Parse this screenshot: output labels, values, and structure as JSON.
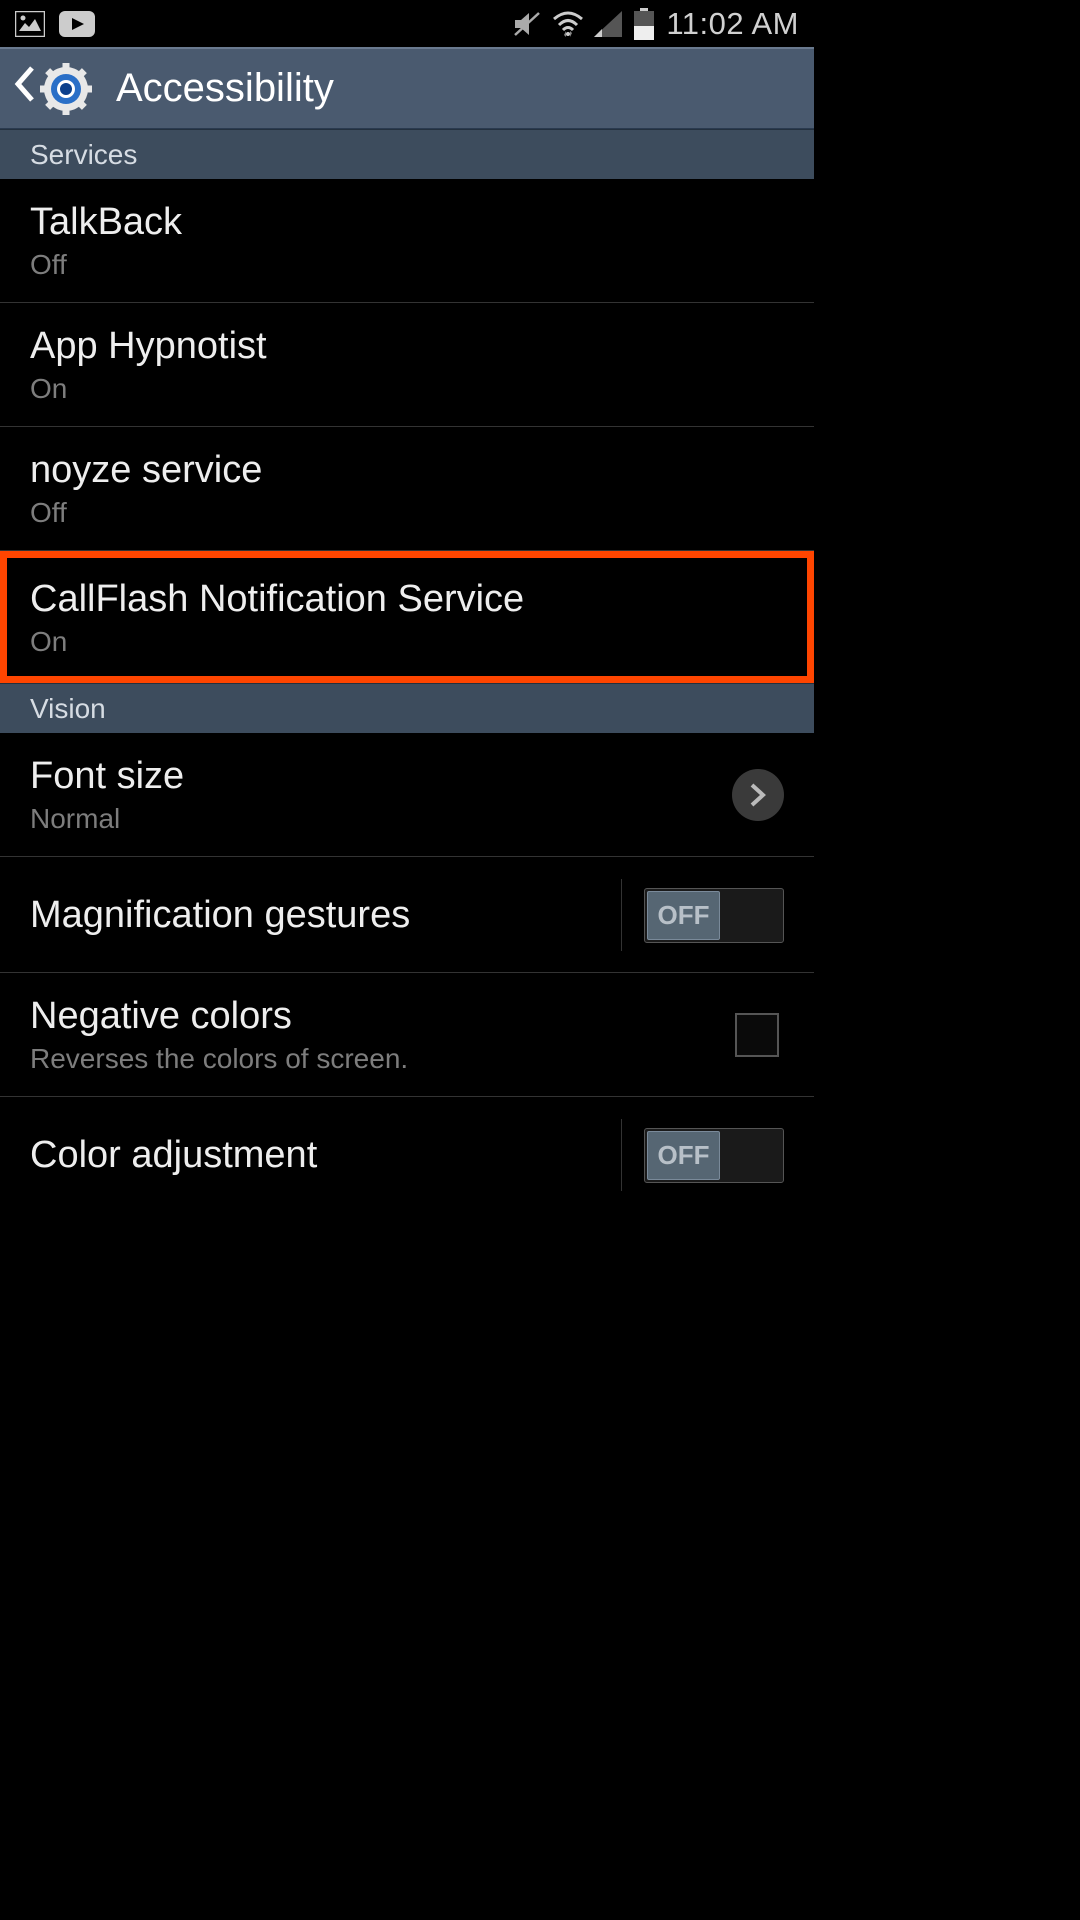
{
  "status_bar": {
    "time": "11:02 AM"
  },
  "header": {
    "title": "Accessibility"
  },
  "sections": {
    "services": {
      "label": "Services",
      "items": [
        {
          "title": "TalkBack",
          "subtitle": "Off"
        },
        {
          "title": "App Hypnotist",
          "subtitle": "On"
        },
        {
          "title": "noyze service",
          "subtitle": "Off"
        },
        {
          "title": "CallFlash Notification Service",
          "subtitle": "On"
        }
      ]
    },
    "vision": {
      "label": "Vision",
      "items": [
        {
          "title": "Font size",
          "subtitle": "Normal",
          "type": "chevron"
        },
        {
          "title": "Magnification gestures",
          "type": "toggle",
          "toggle_text": "OFF"
        },
        {
          "title": "Negative colors",
          "subtitle": "Reverses the colors of screen.",
          "type": "checkbox"
        },
        {
          "title": "Color adjustment",
          "type": "toggle",
          "toggle_text": "OFF"
        }
      ]
    }
  }
}
